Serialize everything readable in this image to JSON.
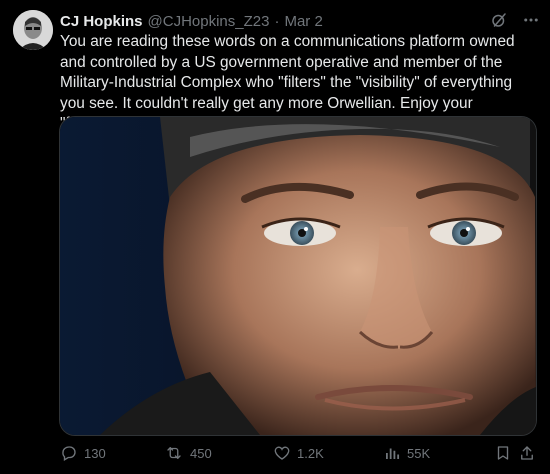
{
  "author": {
    "name": "CJ Hopkins",
    "handle": "@CJHopkins_Z23",
    "separator": "·",
    "date": "Mar 2"
  },
  "tweet": {
    "text": "You are reading these words on a communications platform owned and controlled by a US government operative and member of the Military-Industrial Complex who \"filters\" the \"visibility\" of everything you see. It couldn't really get any more Orwellian. Enjoy your \"freedom.\""
  },
  "header_icons": [
    "grok-icon",
    "more-icon"
  ],
  "actions": {
    "replies": "130",
    "reposts": "450",
    "likes": "1.2K",
    "views": "55K"
  },
  "colors": {
    "background": "#000000",
    "text": "#e7e9ea",
    "secondary": "#71767b"
  }
}
